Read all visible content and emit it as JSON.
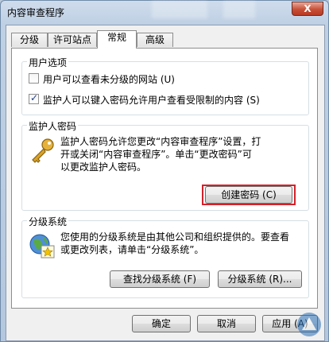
{
  "window": {
    "title": "内容审查程序",
    "close_glyph": "X"
  },
  "tabs": [
    {
      "label": "分级",
      "active": false
    },
    {
      "label": "许可站点",
      "active": false
    },
    {
      "label": "常规",
      "active": true
    },
    {
      "label": "高级",
      "active": false
    }
  ],
  "user_options": {
    "title": "用户选项",
    "options": [
      {
        "label": "用户可以查看未分级的网站 (U)",
        "checked": false
      },
      {
        "label": "监护人可以键入密码允许用户查看受限制的内容 (S)",
        "checked": true
      }
    ]
  },
  "supervisor_password": {
    "title": "监护人密码",
    "description_lines": [
      "监护人密码允许您更改“内容审查程序”设置，打",
      "开或关闭“内容审查程序”。单击“更改密码”可",
      "以更改监护人密码。"
    ],
    "icon": "key-icon",
    "button_label": "创建密码 (C)"
  },
  "rating_systems": {
    "title": "分级系统",
    "description_lines": [
      "您使用的分级系统是由其他公司和组织提供的。要查看",
      "或更改列表，请单击“分级系统”。"
    ],
    "icon": "globe-certificate-icon",
    "find_button_label": "查找分级系统 (F)",
    "rating_button_label": "分级系统 (R)..."
  },
  "footer": {
    "ok_label": "确定",
    "cancel_label": "取消",
    "apply_label": "应用 (A)"
  },
  "colors": {
    "highlight": "#d2212a",
    "accent": "#1f3f8f"
  }
}
